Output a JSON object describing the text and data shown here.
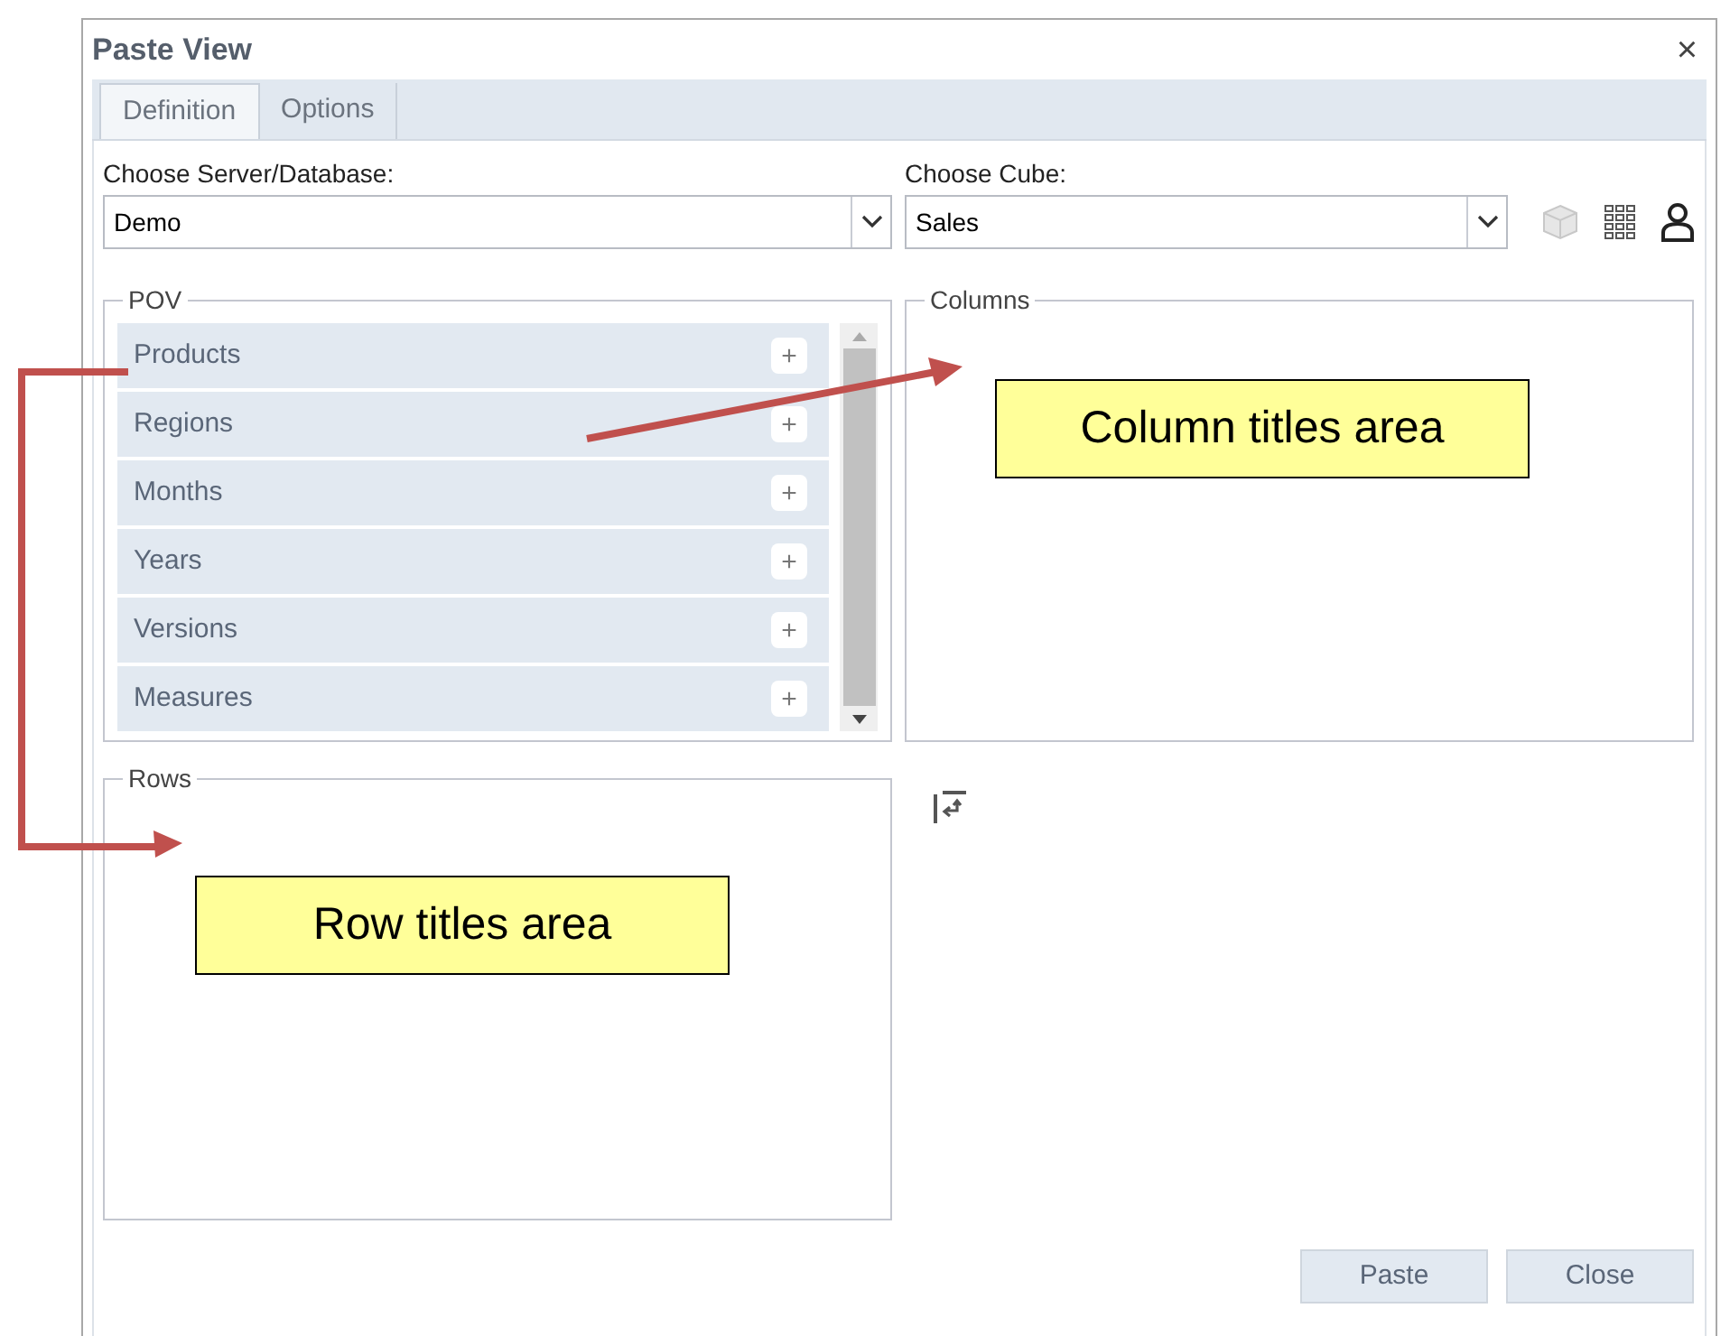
{
  "window": {
    "title": "Paste View",
    "close": "×"
  },
  "tabs": [
    {
      "label": "Definition",
      "selected": true
    },
    {
      "label": "Options",
      "selected": false
    }
  ],
  "server": {
    "label": "Choose Server/Database:",
    "value": "Demo"
  },
  "cube": {
    "label": "Choose Cube:",
    "value": "Sales"
  },
  "pov": {
    "title": "POV",
    "items": [
      {
        "label": "Products",
        "add": "+"
      },
      {
        "label": "Regions",
        "add": "+"
      },
      {
        "label": "Months",
        "add": "+"
      },
      {
        "label": "Years",
        "add": "+"
      },
      {
        "label": "Versions",
        "add": "+"
      },
      {
        "label": "Measures",
        "add": "+"
      }
    ]
  },
  "columns": {
    "title": "Columns"
  },
  "rows": {
    "title": "Rows"
  },
  "buttons": [
    "Paste",
    "Close"
  ],
  "annotations": [
    {
      "kind": "straight",
      "text": "Column titles area"
    },
    {
      "kind": "elbow",
      "text": "Row titles area"
    }
  ]
}
